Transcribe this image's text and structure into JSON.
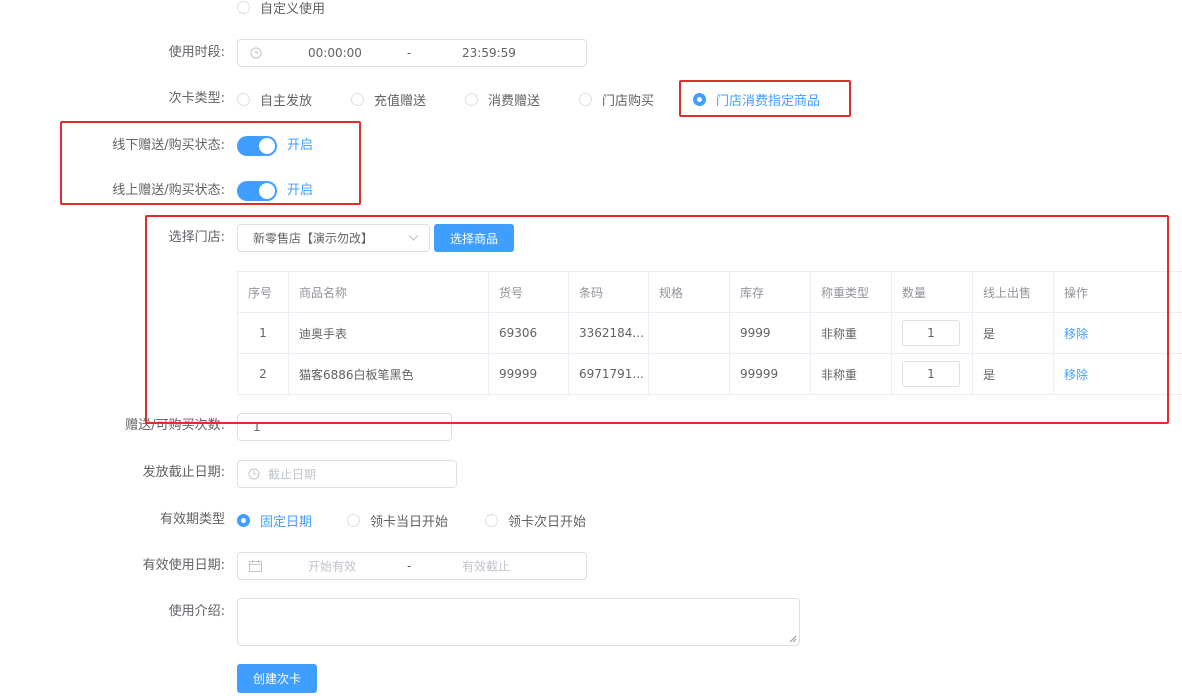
{
  "form": {
    "top_radio": "自定义使用",
    "time_period": {
      "label": "使用时段:",
      "start": "00:00:00",
      "sep": "-",
      "end": "23:59:59"
    },
    "card_type": {
      "label": "次卡类型:",
      "options": [
        "自主发放",
        "充值赠送",
        "消费赠送",
        "门店购买",
        "门店消费指定商品"
      ],
      "selected": "门店消费指定商品"
    },
    "offline_status": {
      "label": "线下赠送/购买状态:",
      "value": "开启"
    },
    "online_status": {
      "label": "线上赠送/购买状态:",
      "value": "开启"
    },
    "store": {
      "label": "选择门店:",
      "value": "新零售店【演示勿改】",
      "select_goods_button": "选择商品"
    },
    "gift_count": {
      "label": "赠送/可购买次数:",
      "value": "1"
    },
    "deadline": {
      "label": "发放截止日期:",
      "placeholder": "截止日期"
    },
    "validity_type": {
      "label": "有效期类型",
      "options": [
        "固定日期",
        "领卡当日开始",
        "领卡次日开始"
      ],
      "selected": "固定日期"
    },
    "valid_dates": {
      "label": "有效使用日期:",
      "start_placeholder": "开始有效",
      "sep": "-",
      "end_placeholder": "有效截止"
    },
    "intro": {
      "label": "使用介绍:"
    },
    "submit": "创建次卡"
  },
  "goods_table": {
    "headers": [
      "序号",
      "商品名称",
      "货号",
      "条码",
      "规格",
      "库存",
      "称重类型",
      "数量",
      "线上出售",
      "操作"
    ],
    "rows": [
      {
        "index": "1",
        "name": "迪奥手表",
        "sku": "69306",
        "barcode": "3362184...",
        "spec": "",
        "stock": "9999",
        "weight_type": "非称重",
        "qty": "1",
        "online": "是",
        "action": "移除"
      },
      {
        "index": "2",
        "name": "猫客6886白板笔黑色",
        "sku": "99999",
        "barcode": "6971791...",
        "spec": "",
        "stock": "99999",
        "weight_type": "非称重",
        "qty": "1",
        "online": "是",
        "action": "移除"
      }
    ]
  },
  "colors": {
    "primary": "#409eff",
    "highlight_box": "#e02d2d"
  },
  "icons": {
    "time": "clock-icon",
    "date": "calendar-icon",
    "dropdown": "chevron-down-icon"
  }
}
